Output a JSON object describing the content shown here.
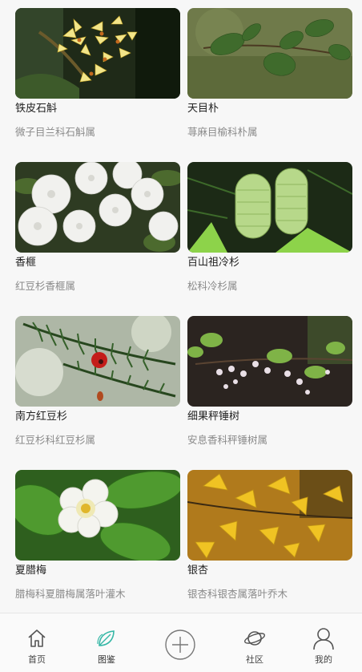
{
  "plants": [
    {
      "name": "铁皮石斛",
      "taxon": "微子目兰科石斛属"
    },
    {
      "name": "天目朴",
      "taxon": "荨麻目榆科朴属"
    },
    {
      "name": "香榧",
      "taxon": "红豆杉香榧属"
    },
    {
      "name": "百山祖冷杉",
      "taxon": "松科冷杉属"
    },
    {
      "name": "南方红豆杉",
      "taxon": "红豆杉科红豆杉属"
    },
    {
      "name": "细果秤锤树",
      "taxon": "安息香科秤锤树属"
    },
    {
      "name": "夏腊梅",
      "taxon": "腊梅科夏腊梅属落叶灌木"
    },
    {
      "name": "银杏",
      "taxon": "银杏科银杏属落叶乔木"
    }
  ],
  "tabbar": {
    "items": [
      {
        "label": "首页",
        "icon": "home-icon"
      },
      {
        "label": "图鉴",
        "icon": "leaf-icon"
      },
      {
        "label": "",
        "icon": "add-circle-icon"
      },
      {
        "label": "社区",
        "icon": "planet-icon"
      },
      {
        "label": "我的",
        "icon": "user-icon"
      }
    ],
    "active_index": 1,
    "accent_color": "#35b7a6"
  },
  "colors": {
    "background": "#f7f7f7",
    "name_text": "#222222",
    "taxon_text": "#8a8a8a"
  }
}
